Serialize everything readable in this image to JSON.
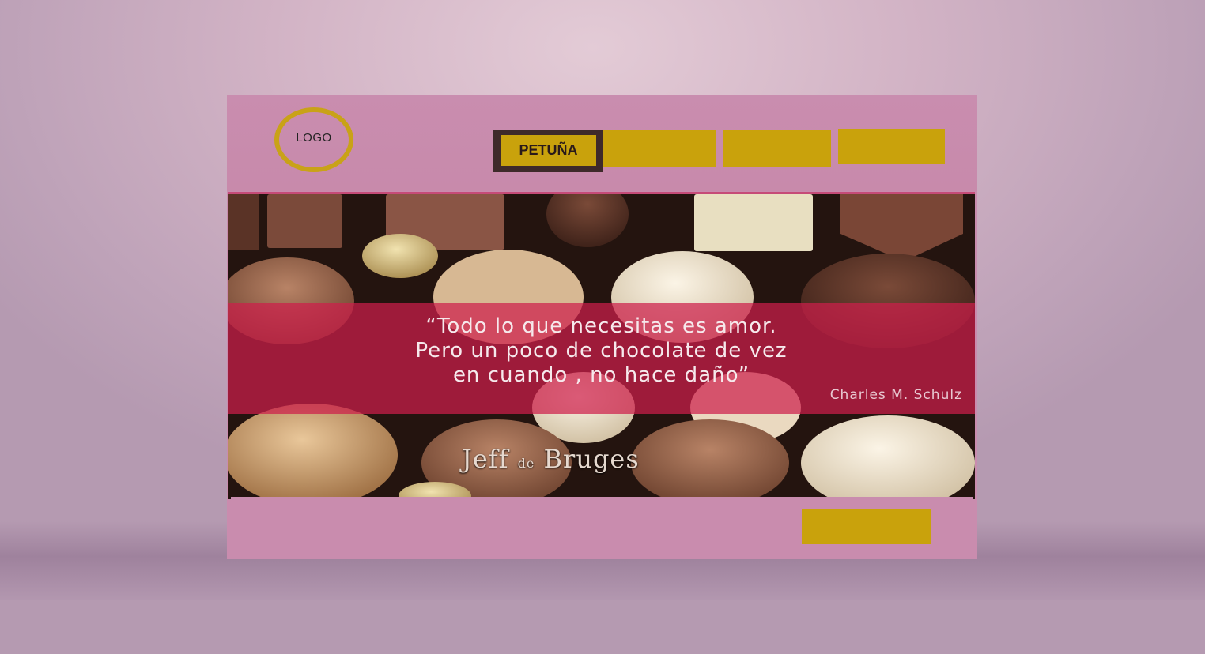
{
  "logo": {
    "text": "LOGO"
  },
  "nav": {
    "items": [
      {
        "label": "PETUÑA",
        "active": true
      },
      {
        "label": ""
      },
      {
        "label": ""
      },
      {
        "label": ""
      }
    ]
  },
  "hero": {
    "quote_lines": [
      "“Todo lo que necesitas es amor.",
      "Pero un poco de chocolate de vez",
      "en cuando , no hace daño”"
    ],
    "author": "Charles M. Schulz",
    "brand_part1": "Jeff ",
    "brand_part2": "de",
    "brand_part3": " Bruges"
  },
  "footer": {
    "button_label": ""
  },
  "colors": {
    "page_bg": "#c98cae",
    "accent_gold": "#c9a20c",
    "banner_red": "#cd1e4b",
    "active_border": "#3e2a2a"
  }
}
